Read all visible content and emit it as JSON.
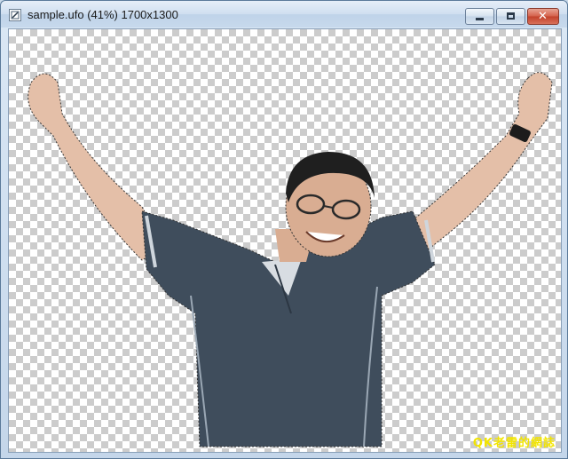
{
  "window": {
    "title": "sample.ufo (41%) 1700x1300",
    "buttons": {
      "minimize": "minimize",
      "maximize": "maximize",
      "close": "✕"
    }
  },
  "canvas": {
    "background": "transparency-checkerboard",
    "watermark": "QK老雷的網誌",
    "colors": {
      "checker_dark": "#cccccc",
      "checker_light": "#ffffff",
      "shirt": "#3f4d5c",
      "skin": "#e0b8a0",
      "watermark": "#f2e400"
    }
  },
  "icons": [
    "document-icon",
    "minimize-icon",
    "maximize-icon",
    "close-icon"
  ]
}
